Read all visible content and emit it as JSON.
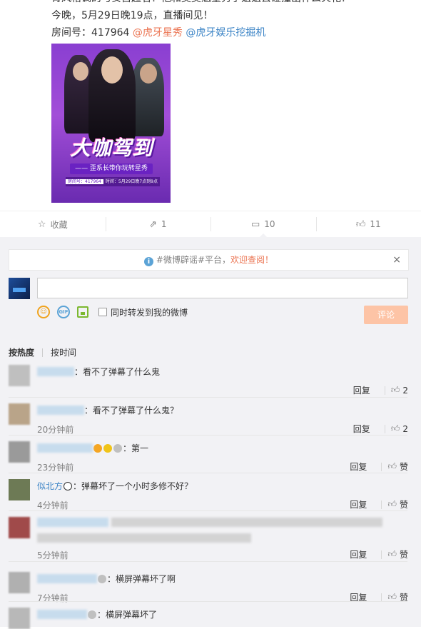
{
  "post": {
    "line0": "肯风格调的与安自超名！他和莫莫魁星秀手姐姐去碰撞出什么火花？",
    "line1": "今晚，5月29日晚19点，直播间见！",
    "line2_prefix": "房间号：417964 ",
    "mention1": "@虎牙星秀",
    "mention2": "@虎牙娱乐挖掘机",
    "poster": {
      "title": "大咖驾到",
      "subtitle": "—— 歪系长带你玩转星秀 ——",
      "room_label": "房间号：417964",
      "time_label": "时间：5月29日晚7点到9点"
    }
  },
  "actions": {
    "favorite": {
      "icon": "star-icon",
      "label": "收藏"
    },
    "forward": {
      "icon": "share-icon",
      "count": "1"
    },
    "comment": {
      "icon": "comment-icon",
      "count": "10"
    },
    "like": {
      "icon": "thumb-up-icon",
      "count": "11"
    }
  },
  "notice": {
    "prefix": "#微博辟谣#平台，",
    "link": "欢迎查阅！",
    "close": "×"
  },
  "composer": {
    "checkbox_label": "同时转发到我的微博",
    "submit_label": "评论",
    "gif_label": "GIF"
  },
  "sort": {
    "hot": "按热度",
    "time": "按时间"
  },
  "comments": [
    {
      "text": "：看不了弹幕了什么鬼",
      "time": "",
      "reply": "回复",
      "likes": "2"
    },
    {
      "text": "：看不了弹幕了什么鬼？",
      "time": "20分钟前",
      "reply": "回复",
      "likes": "2"
    },
    {
      "text": "：第一",
      "time": "23分钟前",
      "reply": "回复",
      "likes": "赞"
    },
    {
      "nick": "似北方",
      "text": "：弹幕坏了一个小时多修不好？",
      "time": "4分钟前",
      "reply": "回复",
      "likes": "赞"
    },
    {
      "text": "",
      "time": "5分钟前",
      "reply": "回复",
      "likes": "赞"
    },
    {
      "text": "：横屏弹幕坏了啊",
      "time": "7分钟前",
      "reply": "回复",
      "likes": "赞"
    },
    {
      "text": "：横屏弹幕坏了",
      "time": "",
      "reply": "",
      "likes": ""
    }
  ],
  "colors": {
    "link": "#eb7350",
    "blue": "#3c84c6",
    "background": "#f2f2f5",
    "submit": "#fdc4a6"
  }
}
